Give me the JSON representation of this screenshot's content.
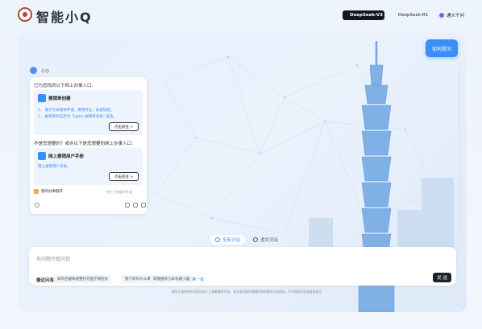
{
  "header": {
    "brand": "智能小Q",
    "models": [
      {
        "label": "DeepSeek-V3",
        "active": true
      },
      {
        "label": "DeepSeek-R1",
        "active": false
      },
      {
        "label": "通义千问",
        "active": false
      }
    ]
  },
  "help_button": "如何提问",
  "bot_name": "小Q",
  "card": {
    "intro": "已为您找到以下网上办事入口:",
    "entry1": {
      "title": "报销单创建",
      "lines": [
        "1、 端子方关明项申请，费用开立，再提钱结。",
        "2、 报销单状态改为 \"Egate-报销单审核\" 表签。"
      ],
      "button": "点击前往 >"
    },
    "question": "不是您想要的？或许以下是您想要的网上办事入口:",
    "entry2": {
      "title": "网上报销用户手册",
      "line": "网上报销用户手册。",
      "button": "点击前往 >"
    },
    "tag": "我的办事额开",
    "ai_note": "由人工智能AI生成"
  },
  "tabs": [
    {
      "label": "全新对话",
      "active": true
    },
    {
      "label": "遗文对话",
      "active": false
    }
  ],
  "input": {
    "placeholder": "有问题尽管问我",
    "recent_label": "最近问答",
    "recent_questions": [
      "如何合理和规整针先医疗保险办",
      "我下周有什么课",
      "帮我推荐几本有趣小说"
    ],
    "swap_label": "换一批",
    "send": "发 送"
  },
  "disclaimer": "服务生成的所有内容均由人工智能模型生成，其生成内容的准确性和完整性无法保证，不代表我们的态度或观点",
  "colors": {
    "accent": "#3a8ef6",
    "dark": "#1f2228"
  }
}
